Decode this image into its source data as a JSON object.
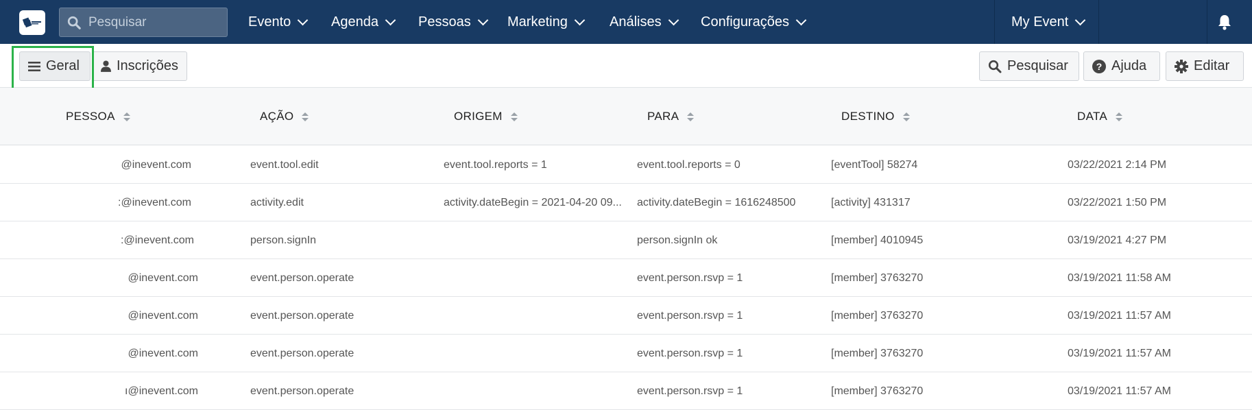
{
  "nav": {
    "search_placeholder": "Pesquisar",
    "items": [
      {
        "label": "Evento"
      },
      {
        "label": "Agenda"
      },
      {
        "label": "Pessoas"
      },
      {
        "label": "Marketing"
      },
      {
        "label": "Análises"
      },
      {
        "label": "Configurações"
      }
    ],
    "event_selector": "My Event",
    "bell_icon": "bell-icon",
    "colors": {
      "navbar": "#183a63",
      "highlight": "#2cb34a"
    }
  },
  "toolbar": {
    "tabs": [
      {
        "label": "Geral",
        "icon": "menu-icon",
        "active": true
      },
      {
        "label": "Inscrições",
        "icon": "user-icon",
        "active": false
      }
    ],
    "actions": [
      {
        "label": "Pesquisar",
        "icon": "search-icon"
      },
      {
        "label": "Ajuda",
        "icon": "help-icon"
      },
      {
        "label": "Editar",
        "icon": "gear-icon"
      }
    ]
  },
  "table": {
    "columns": [
      "PESSOA",
      "AÇÃO",
      "ORIGEM",
      "PARA",
      "DESTINO",
      "DATA"
    ],
    "rows": [
      {
        "pessoa": "@inevent.com",
        "acao": "event.tool.edit",
        "origem": "event.tool.reports = 1",
        "para": "event.tool.reports = 0",
        "destino": "[eventTool] 58274",
        "data": "03/22/2021 2:14 PM"
      },
      {
        "pessoa": ":@inevent.com",
        "acao": "activity.edit",
        "origem": "activity.dateBegin = 2021-04-20 09...",
        "para": "activity.dateBegin = 1616248500",
        "destino": "[activity] 431317",
        "data": "03/22/2021 1:50 PM"
      },
      {
        "pessoa": ":@inevent.com",
        "acao": "person.signIn",
        "origem": "",
        "para": "person.signIn ok",
        "destino": "[member] 4010945",
        "data": "03/19/2021 4:27 PM"
      },
      {
        "pessoa": "@inevent.com",
        "acao": "event.person.operate",
        "origem": "",
        "para": "event.person.rsvp = 1",
        "destino": "[member] 3763270",
        "data": "03/19/2021 11:58 AM"
      },
      {
        "pessoa": "@inevent.com",
        "acao": "event.person.operate",
        "origem": "",
        "para": "event.person.rsvp = 1",
        "destino": "[member] 3763270",
        "data": "03/19/2021 11:57 AM"
      },
      {
        "pessoa": "@inevent.com",
        "acao": "event.person.operate",
        "origem": "",
        "para": "event.person.rsvp = 1",
        "destino": "[member] 3763270",
        "data": "03/19/2021 11:57 AM"
      },
      {
        "pessoa": "ı@inevent.com",
        "acao": "event.person.operate",
        "origem": "",
        "para": "event.person.rsvp = 1",
        "destino": "[member] 3763270",
        "data": "03/19/2021 11:57 AM"
      }
    ]
  }
}
